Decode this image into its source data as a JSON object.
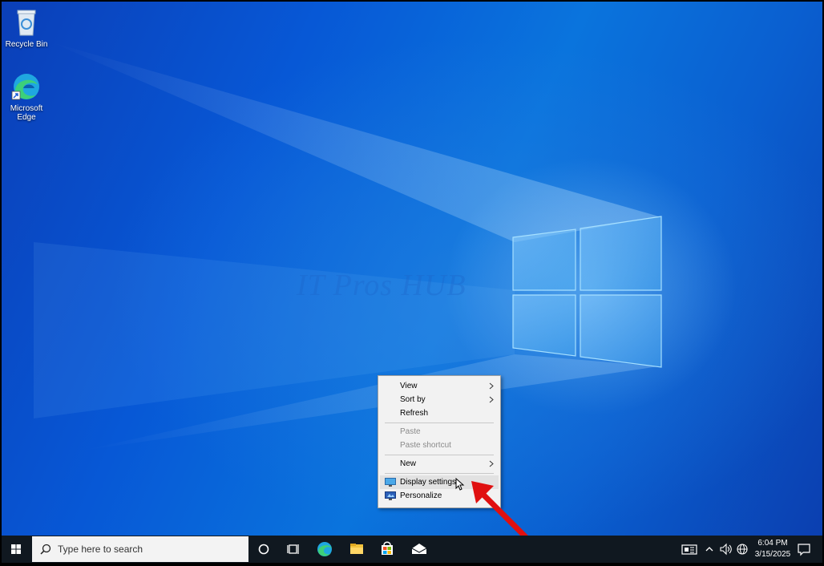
{
  "desktop": {
    "icons": [
      {
        "label": "Recycle Bin"
      },
      {
        "label": "Microsoft Edge"
      }
    ],
    "watermark": "IT Pros HUB"
  },
  "context_menu": {
    "items": [
      {
        "label": "View",
        "submenu": true,
        "enabled": true
      },
      {
        "label": "Sort by",
        "submenu": true,
        "enabled": true
      },
      {
        "label": "Refresh",
        "submenu": false,
        "enabled": true
      },
      {
        "label": "Paste",
        "submenu": false,
        "enabled": false
      },
      {
        "label": "Paste shortcut",
        "submenu": false,
        "enabled": false
      },
      {
        "label": "New",
        "submenu": true,
        "enabled": true
      },
      {
        "label": "Display settings",
        "submenu": false,
        "enabled": true,
        "icon": "display-icon",
        "highlighted": true
      },
      {
        "label": "Personalize",
        "submenu": false,
        "enabled": true,
        "icon": "personalize-icon"
      }
    ]
  },
  "taskbar": {
    "search_placeholder": "Type here to search",
    "pinned": [
      "cortana-icon",
      "task-view-icon",
      "edge-icon",
      "file-explorer-icon",
      "store-icon",
      "mail-icon"
    ],
    "tray": {
      "time": "6:04 PM",
      "date": "3/15/2025"
    }
  },
  "colors": {
    "accent": "#0a6fd8",
    "taskbar": "#101820",
    "annotation_arrow": "#e01010"
  }
}
